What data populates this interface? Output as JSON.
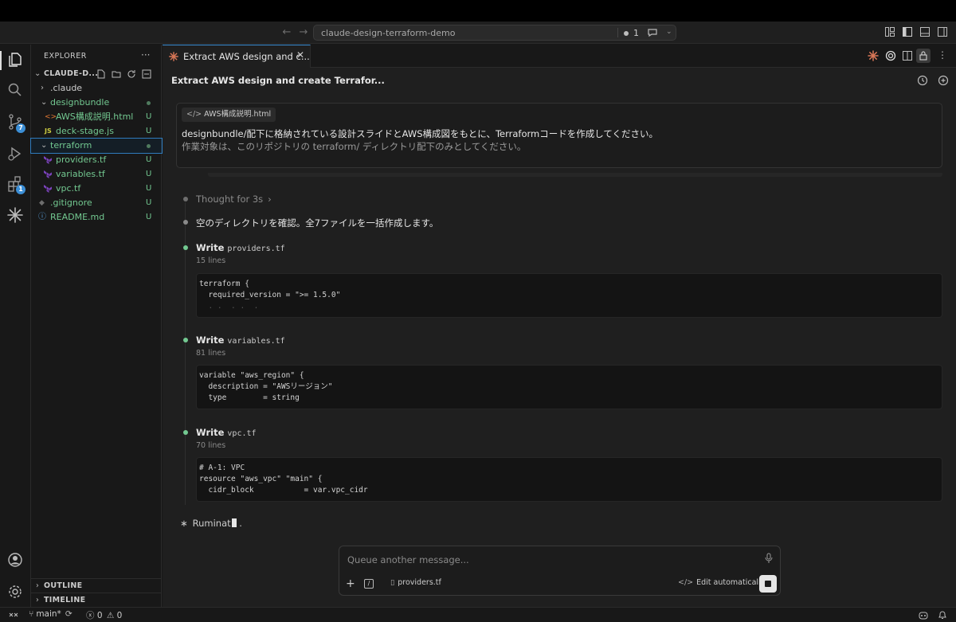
{
  "titlebar": {
    "search_title": "claude-design-terraform-demo",
    "problem_count": "1"
  },
  "activity": {
    "scm_badge": "7",
    "ext_badge": "1"
  },
  "sidebar": {
    "header": "EXPLORER",
    "root": "CLAUDE-D...",
    "items": [
      {
        "label": ".claude",
        "status": ""
      },
      {
        "label": "designbundle",
        "status": ""
      },
      {
        "label": "AWS構成説明.html",
        "status": "U"
      },
      {
        "label": "deck-stage.js",
        "status": "U",
        "icon_text": "JS"
      },
      {
        "label": "terraform",
        "status": ""
      },
      {
        "label": "providers.tf",
        "status": "U"
      },
      {
        "label": "variables.tf",
        "status": "U"
      },
      {
        "label": "vpc.tf",
        "status": "U"
      },
      {
        "label": ".gitignore",
        "status": "U"
      },
      {
        "label": "README.md",
        "status": "U"
      }
    ],
    "outline": "OUTLINE",
    "timeline": "TIMELINE"
  },
  "editor": {
    "tab_label": "Extract AWS design and c...",
    "conversation_title": "Extract AWS design and create Terrafor..."
  },
  "chat": {
    "attachment": "AWS構成説明.html",
    "user_line1": "designbundle/配下に格納されている設計スライドとAWS構成図をもとに、Terraformコードを作成してください。",
    "user_line2": "作業対象は、このリポジトリの terraform/ ディレクトリ配下のみとしてください。",
    "thought": "Thought for 3s",
    "assistant_text": "空のディレクトリを確認。全7ファイルを一括作成します。",
    "writes": [
      {
        "action": "Write",
        "file": "providers.tf",
        "lines": "15 lines",
        "code": [
          "terraform {",
          "  required_version = \">= 1.5.0\"",
          ""
        ]
      },
      {
        "action": "Write",
        "file": "variables.tf",
        "lines": "81 lines",
        "code": [
          "variable \"aws_region\" {",
          "  description = \"AWSリージョン\"",
          "  type        = string"
        ]
      },
      {
        "action": "Write",
        "file": "vpc.tf",
        "lines": "70 lines",
        "code": [
          "# A-1: VPC",
          "resource \"aws_vpc\" \"main\" {",
          "  cidr_block           = var.vpc_cidr"
        ]
      }
    ],
    "status_text": "Ruminat",
    "status_suffix": " ."
  },
  "composer": {
    "placeholder": "Queue another message...",
    "file_chip": "providers.tf",
    "edit_mode": "Edit automatically"
  },
  "statusbar": {
    "branch": "main*",
    "errors": "0",
    "warnings": "0"
  },
  "colors": {
    "accent": "#3c8fd6",
    "untracked": "#73c991",
    "claude": "#d97757"
  }
}
